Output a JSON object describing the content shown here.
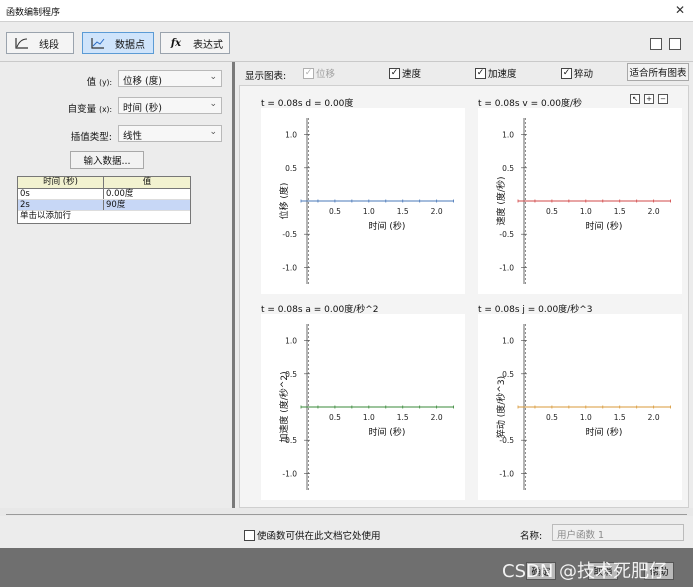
{
  "window": {
    "title": "函数编制程序",
    "close": "✕"
  },
  "toolbar": {
    "buttons": [
      {
        "label": "线段"
      },
      {
        "label": "数据点"
      },
      {
        "label": "表达式"
      }
    ]
  },
  "left": {
    "value_label": "值",
    "value_key": "(y):",
    "value_selected": "位移 (度)",
    "indep_label": "自变量",
    "indep_key": "(x):",
    "indep_selected": "时间 (秒)",
    "interp_label": "插值类型:",
    "interp_selected": "线性",
    "input_button": "输入数据...",
    "table": {
      "headers": [
        "时间 (秒)",
        "值"
      ],
      "rows": [
        [
          "0s",
          "0.00度"
        ],
        [
          "2s",
          "90度"
        ]
      ],
      "add_row": "单击以添加行"
    }
  },
  "right": {
    "show_label": "显示图表:",
    "checks": [
      {
        "label": "位移",
        "checked": true,
        "disabled": true
      },
      {
        "label": "速度",
        "checked": true,
        "disabled": false
      },
      {
        "label": "加速度",
        "checked": true,
        "disabled": false
      },
      {
        "label": "猝动",
        "checked": true,
        "disabled": false
      }
    ],
    "fit_button": "适合所有图表",
    "plots": [
      {
        "header": "t = 0.08s  d = 0.00度",
        "ylabel": "位移 (度)",
        "color": "#4a78b8"
      },
      {
        "header": "t = 0.08s  v = 0.00度/秒",
        "ylabel": "速度 (度/秒)",
        "color": "#d24a4a"
      },
      {
        "header": "t = 0.08s  a = 0.00度/秒^2",
        "ylabel": "加速度 (度/秒^2)",
        "color": "#3a8a3a"
      },
      {
        "header": "t = 0.08s  j = 0.00度/秒^3",
        "ylabel": "猝动 (度/秒^3)",
        "color": "#d99a3a"
      }
    ],
    "xlabel": "时间 (秒)",
    "xticks": [
      "0.5",
      "1.0",
      "1.5",
      "2.0"
    ],
    "yticks": [
      "1.0",
      "0.5",
      "-0.5",
      "-1.0"
    ]
  },
  "footer": {
    "share_label": "使函数可供在此文档它处使用",
    "name_label": "名称:",
    "name_value": "用户函数 1"
  },
  "bottom": {
    "buttons": [
      "确定",
      "取消",
      "帮助"
    ],
    "watermark": "CSDN @技术死肥仔"
  },
  "chart_data": [
    {
      "type": "line",
      "x": [
        0,
        0.25,
        0.5,
        0.75,
        1.0,
        1.25,
        1.5,
        1.75,
        2.0,
        2.25
      ],
      "series": [
        {
          "name": "位移 (度)",
          "values": [
            0,
            0,
            0,
            0,
            0,
            0,
            0,
            0,
            0,
            0
          ]
        }
      ],
      "xlabel": "时间 (秒)",
      "ylabel": "位移 (度)",
      "ylim": [
        -1.25,
        1.25
      ]
    },
    {
      "type": "line",
      "x": [
        0,
        0.25,
        0.5,
        0.75,
        1.0,
        1.25,
        1.5,
        1.75,
        2.0,
        2.25
      ],
      "series": [
        {
          "name": "速度 (度/秒)",
          "values": [
            0,
            0,
            0,
            0,
            0,
            0,
            0,
            0,
            0,
            0
          ]
        }
      ],
      "xlabel": "时间 (秒)",
      "ylabel": "速度 (度/秒)",
      "ylim": [
        -1.25,
        1.25
      ]
    },
    {
      "type": "line",
      "x": [
        0,
        0.25,
        0.5,
        0.75,
        1.0,
        1.25,
        1.5,
        1.75,
        2.0,
        2.25
      ],
      "series": [
        {
          "name": "加速度 (度/秒^2)",
          "values": [
            0,
            0,
            0,
            0,
            0,
            0,
            0,
            0,
            0,
            0
          ]
        }
      ],
      "xlabel": "时间 (秒)",
      "ylabel": "加速度 (度/秒^2)",
      "ylim": [
        -1.25,
        1.25
      ]
    },
    {
      "type": "line",
      "x": [
        0,
        0.25,
        0.5,
        0.75,
        1.0,
        1.25,
        1.5,
        1.75,
        2.0,
        2.25
      ],
      "series": [
        {
          "name": "猝动 (度/秒^3)",
          "values": [
            0,
            0,
            0,
            0,
            0,
            0,
            0,
            0,
            0,
            0
          ]
        }
      ],
      "xlabel": "时间 (秒)",
      "ylabel": "猝动 (度/秒^3)",
      "ylim": [
        -1.25,
        1.25
      ]
    }
  ]
}
